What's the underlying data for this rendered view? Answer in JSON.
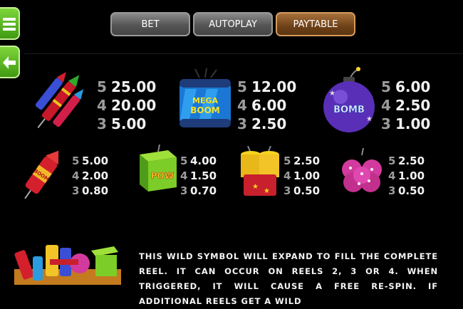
{
  "menu": {
    "menu_icon": "hamburger-icon",
    "back_icon": "arrow-left-icon"
  },
  "tabs": [
    {
      "label": "BET",
      "active": false
    },
    {
      "label": "AUTOPLAY",
      "active": false
    },
    {
      "label": "PAYTABLE",
      "active": true
    }
  ],
  "symbols": [
    {
      "name": "rocket-trio",
      "payouts": [
        {
          "count": "5",
          "value": "25.00"
        },
        {
          "count": "4",
          "value": "20.00"
        },
        {
          "count": "3",
          "value": "5.00"
        }
      ]
    },
    {
      "name": "mega-boom",
      "label": "MEGA BOOM",
      "payouts": [
        {
          "count": "5",
          "value": "12.00"
        },
        {
          "count": "4",
          "value": "6.00"
        },
        {
          "count": "3",
          "value": "2.50"
        }
      ]
    },
    {
      "name": "bomb",
      "label": "BOMB",
      "payouts": [
        {
          "count": "5",
          "value": "6.00"
        },
        {
          "count": "4",
          "value": "2.50"
        },
        {
          "count": "3",
          "value": "1.00"
        }
      ]
    },
    {
      "name": "boom-rocket",
      "label": "BOOM",
      "payouts": [
        {
          "count": "5",
          "value": "5.00"
        },
        {
          "count": "4",
          "value": "2.00"
        },
        {
          "count": "3",
          "value": "0.80"
        }
      ]
    },
    {
      "name": "pow-box",
      "label": "POW",
      "payouts": [
        {
          "count": "5",
          "value": "4.00"
        },
        {
          "count": "4",
          "value": "1.50"
        },
        {
          "count": "3",
          "value": "0.70"
        }
      ]
    },
    {
      "name": "double-tube",
      "payouts": [
        {
          "count": "5",
          "value": "2.50"
        },
        {
          "count": "4",
          "value": "1.00"
        },
        {
          "count": "3",
          "value": "0.50"
        }
      ]
    },
    {
      "name": "pink-cake",
      "payouts": [
        {
          "count": "5",
          "value": "2.50"
        },
        {
          "count": "4",
          "value": "1.00"
        },
        {
          "count": "3",
          "value": "0.50"
        }
      ]
    }
  ],
  "wild": {
    "description": "THIS WILD SYMBOL WILL EXPAND TO FILL THE COMPLETE REEL. IT CAN OCCUR ON REELS 2, 3 OR 4. WHEN TRIGGERED, IT WILL CAUSE A FREE RE-SPIN. IF ADDITIONAL REELS GET A WILD"
  },
  "colors": {
    "accent_green": "#5cbf22",
    "tab_active": "#7a4a1e",
    "tab_inactive": "#5a5a5a"
  }
}
